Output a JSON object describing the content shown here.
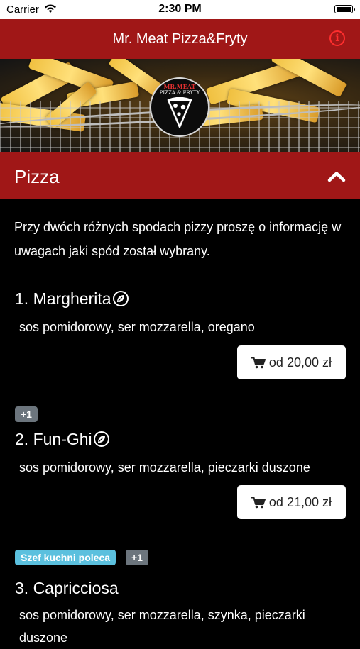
{
  "status_bar": {
    "carrier": "Carrier",
    "time": "2:30 PM"
  },
  "nav": {
    "title": "Mr. Meat Pizza&Fryty",
    "info_icon": "info-icon"
  },
  "hero": {
    "logo_line1": "MR.MEAT",
    "logo_line2": "PIZZA & FRYTY"
  },
  "section": {
    "title": "Pizza",
    "toggle_icon": "chevron-up-icon"
  },
  "notice": "Przy dwóch różnych spodach pizzy proszę o informację w uwagach jaki spód został wybrany.",
  "items": [
    {
      "title": "1. Margherita",
      "desc": "sos pomidorowy, ser mozzarella, oregano",
      "price": "od 20,00 zł",
      "vegetarian": true
    },
    {
      "title": "2. Fun-Ghi",
      "desc": "sos pomidorowy, ser mozzarella, pieczarki duszone",
      "price": "od 21,00 zł",
      "vegetarian": true,
      "badge": "+1"
    },
    {
      "title": "3. Capricciosa",
      "desc": "sos pomidorowy, ser mozzarella, szynka, pieczarki duszone",
      "chef_badge": "Szef kuchni poleca",
      "badge": "+1"
    }
  ],
  "colors": {
    "brand_red": "#a01717",
    "info_red": "#ff2e2e",
    "badge_gray": "#6c757d",
    "badge_cyan": "#5bc0de"
  }
}
